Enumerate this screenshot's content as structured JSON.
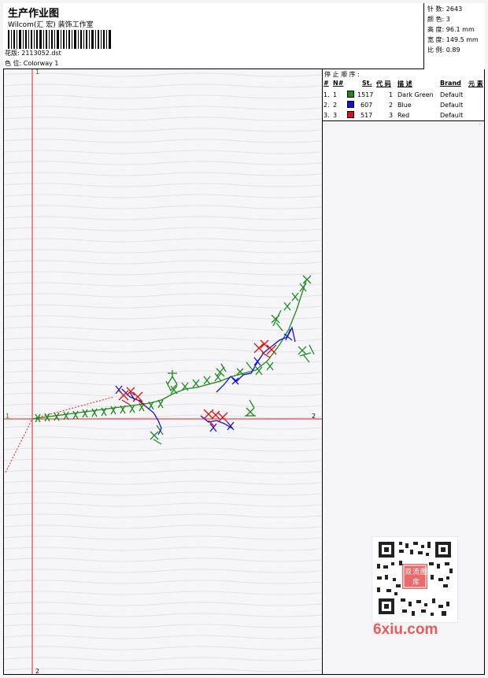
{
  "header": {
    "title": "生产作业图",
    "subtitle": "Wilcom(汇 宏) 装饰工作室",
    "design_label": "花版:",
    "design_value": "2113052.dst",
    "colorway_label": "色 位:",
    "colorway_value": "Colorway 1"
  },
  "stats": [
    {
      "label": "针 数:",
      "value": "2643"
    },
    {
      "label": "颜 色:",
      "value": "3"
    },
    {
      "label": "高 度:",
      "value": "96.1 mm"
    },
    {
      "label": "宽 度:",
      "value": "149.5 mm"
    },
    {
      "label": "比 例:",
      "value": "0.89"
    }
  ],
  "legend": {
    "title": "停 止 顺 序 :",
    "headers": {
      "hash": "#",
      "number": "N#",
      "stitches": "St.",
      "code": "代 码",
      "description": "描 述",
      "brand": "Brand",
      "element": "元 素"
    },
    "rows": [
      {
        "index": "1.",
        "n": "1",
        "color": "#1a8a1a",
        "stitches": "1517",
        "code": "1",
        "description": "Dark Green",
        "brand": "Default"
      },
      {
        "index": "2.",
        "n": "2",
        "color": "#1010e0",
        "stitches": "607",
        "code": "2",
        "description": "Blue",
        "brand": "Default"
      },
      {
        "index": "3.",
        "n": "3",
        "color": "#e01010",
        "stitches": "517",
        "code": "3",
        "description": "Red",
        "brand": "Default"
      }
    ]
  },
  "axes": {
    "top_label": "1",
    "left_label": "1",
    "right_label": "2",
    "bottom_label": "2"
  },
  "watermark": "6xiu.com",
  "qr_center_text": "双 流 图 库",
  "colors": {
    "axis": "#e02020",
    "green": "#1a8a1a",
    "blue": "#1010e0",
    "red": "#e01010"
  }
}
